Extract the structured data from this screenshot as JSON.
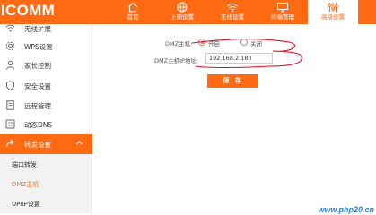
{
  "app": {
    "logo": "ICOMM"
  },
  "nav": {
    "tabs": [
      {
        "label": "首页",
        "icon": "home-icon",
        "active": false
      },
      {
        "label": "上网设置",
        "icon": "globe-icon",
        "active": false
      },
      {
        "label": "无线设置",
        "icon": "wifi-icon",
        "active": false
      },
      {
        "label": "终端管理",
        "icon": "monitor-icon",
        "active": false
      },
      {
        "label": "高级设置",
        "icon": "settings-sliders-icon",
        "active": true
      }
    ]
  },
  "sidebar": {
    "items": [
      {
        "label": "无线扩展",
        "icon": "wireless-extend-icon"
      },
      {
        "label": "WPS设置",
        "icon": "gear-icon"
      },
      {
        "label": "家长控制",
        "icon": "user-icon"
      },
      {
        "label": "安全设置",
        "icon": "shield-icon"
      },
      {
        "label": "远程管理",
        "icon": "document-icon"
      },
      {
        "label": "动态DNS",
        "icon": "dns-icon"
      },
      {
        "label": "转发设置",
        "icon": "forward-icon",
        "expanded": true
      }
    ],
    "subitems": [
      {
        "label": "端口转发",
        "selected": false
      },
      {
        "label": "DMZ主机",
        "selected": true
      },
      {
        "label": "UPnP设置",
        "selected": false
      }
    ]
  },
  "form": {
    "dmz_label": "DMZ主机:",
    "dmz_on_label": "开启",
    "dmz_off_label": "关闭",
    "dmz_enabled": true,
    "ip_label": "DMZ主机IP地址:",
    "ip_value": "192.168.2.180",
    "save_label": "保 存"
  },
  "colors": {
    "accent": "#ff6a13",
    "annotation": "#e0102a",
    "watermark": "#2e7fd0"
  },
  "watermark": "www.php20.cn"
}
